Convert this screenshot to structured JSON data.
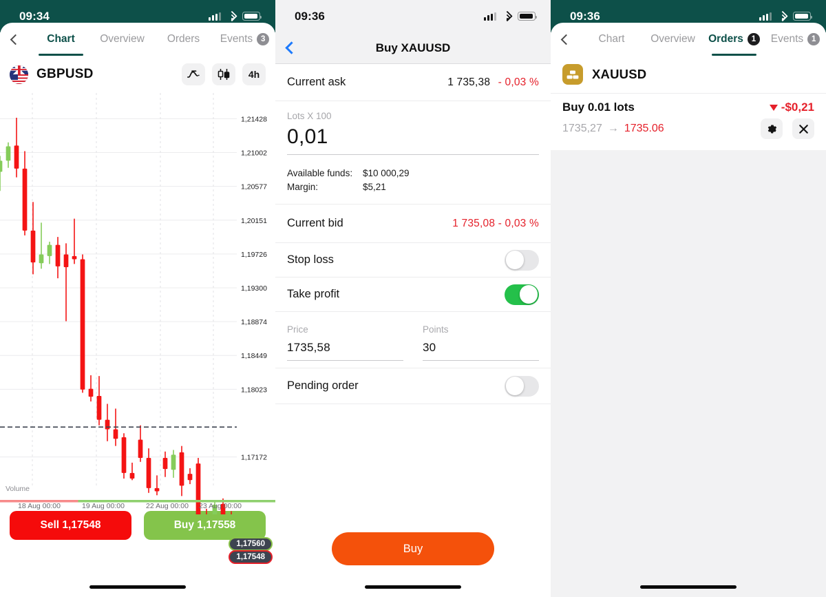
{
  "panel1": {
    "status": {
      "time": "09:34",
      "signal_icon": "cellular-bars-icon",
      "wifi_icon": "wifi-icon",
      "battery_icon": "battery-icon"
    },
    "back_icon": "back-chevron-icon",
    "tabs": [
      {
        "label": "Chart",
        "badge": "",
        "active": true
      },
      {
        "label": "Overview",
        "badge": "",
        "active": false
      },
      {
        "label": "Orders",
        "badge": "",
        "active": false
      },
      {
        "label": "Events",
        "badge": "3",
        "active": false
      }
    ],
    "symbol": {
      "name": "GBPUSD",
      "flag_icon": "gbpusd-flag-icon"
    },
    "tools": [
      {
        "name": "indicators-icon",
        "label": ""
      },
      {
        "name": "candlestick-chart-type-icon",
        "label": ""
      },
      {
        "name": "timeframe-button",
        "label": "4h"
      }
    ],
    "price_tags": {
      "ask": "1,17560",
      "bid": "1,17548"
    },
    "buttons": {
      "sell": "Sell 1,17548",
      "buy": "Buy 1,17558"
    },
    "colors": {
      "teal": "#0d5049",
      "sell_red": "#f50b0b",
      "buy_green": "#84c44b",
      "bull": "#85cc5a",
      "bear": "#f41414"
    }
  },
  "chart_data": {
    "type": "candlestick",
    "title": "GBPUSD",
    "timeframe": "4h",
    "volume_label": "Volume",
    "ylabel": "",
    "xlabel": "",
    "ytick_labels": [
      "1,21428",
      "1,21002",
      "1,20577",
      "1,20151",
      "1,19726",
      "1,19300",
      "1,18874",
      "1,18449",
      "1,18023",
      "1,17172"
    ],
    "ytick_values": [
      1.21428,
      1.21002,
      1.20577,
      1.20151,
      1.19726,
      1.193,
      1.18874,
      1.18449,
      1.18023,
      1.17172
    ],
    "xtick_labels": [
      "18 Aug 00:00",
      "19 Aug 00:00",
      "22 Aug 00:00",
      "23 Aug 00:00"
    ],
    "ylim": [
      1.169,
      1.217
    ],
    "grid": true,
    "current_ask_line": 1.1756,
    "current_bid_line": 1.17548,
    "candles": [
      {
        "o": 1.2076,
        "h": 1.2096,
        "l": 1.2052,
        "c": 1.209
      },
      {
        "o": 1.209,
        "h": 1.2113,
        "l": 1.2081,
        "c": 1.2108
      },
      {
        "o": 1.2109,
        "h": 1.2144,
        "l": 1.2069,
        "c": 1.208
      },
      {
        "o": 1.208,
        "h": 1.2102,
        "l": 1.1996,
        "c": 1.2002
      },
      {
        "o": 1.2002,
        "h": 1.2038,
        "l": 1.1947,
        "c": 1.1962
      },
      {
        "o": 1.1961,
        "h": 1.2012,
        "l": 1.1954,
        "c": 1.1972
      },
      {
        "o": 1.197,
        "h": 1.1988,
        "l": 1.196,
        "c": 1.1984
      },
      {
        "o": 1.1984,
        "h": 1.1994,
        "l": 1.1942,
        "c": 1.1957
      },
      {
        "o": 1.1972,
        "h": 1.1986,
        "l": 1.1888,
        "c": 1.1956
      },
      {
        "o": 1.197,
        "h": 1.2017,
        "l": 1.196,
        "c": 1.1966
      },
      {
        "o": 1.1966,
        "h": 1.1972,
        "l": 1.1798,
        "c": 1.1802
      },
      {
        "o": 1.1803,
        "h": 1.182,
        "l": 1.1787,
        "c": 1.1793
      },
      {
        "o": 1.1794,
        "h": 1.1819,
        "l": 1.1757,
        "c": 1.1764
      },
      {
        "o": 1.1764,
        "h": 1.1784,
        "l": 1.1737,
        "c": 1.1752
      },
      {
        "o": 1.1752,
        "h": 1.1778,
        "l": 1.1731,
        "c": 1.174
      },
      {
        "o": 1.1742,
        "h": 1.1747,
        "l": 1.169,
        "c": 1.1697
      },
      {
        "o": 1.1697,
        "h": 1.171,
        "l": 1.1688,
        "c": 1.169
      },
      {
        "o": 1.1739,
        "h": 1.1757,
        "l": 1.1711,
        "c": 1.1716
      },
      {
        "o": 1.1716,
        "h": 1.1728,
        "l": 1.1672,
        "c": 1.1678
      },
      {
        "o": 1.1678,
        "h": 1.1694,
        "l": 1.1669,
        "c": 1.1674
      },
      {
        "o": 1.1716,
        "h": 1.1724,
        "l": 1.1692,
        "c": 1.1702
      },
      {
        "o": 1.1701,
        "h": 1.1726,
        "l": 1.1691,
        "c": 1.172
      },
      {
        "o": 1.1723,
        "h": 1.1731,
        "l": 1.1668,
        "c": 1.1681
      },
      {
        "o": 1.1696,
        "h": 1.1703,
        "l": 1.1683,
        "c": 1.1688
      },
      {
        "o": 1.1709,
        "h": 1.1716,
        "l": 1.1637,
        "c": 1.1644
      },
      {
        "o": 1.1644,
        "h": 1.1652,
        "l": 1.1632,
        "c": 1.164
      },
      {
        "o": 1.1642,
        "h": 1.1661,
        "l": 1.1638,
        "c": 1.1657
      },
      {
        "o": 1.1658,
        "h": 1.1665,
        "l": 1.1637,
        "c": 1.1642
      },
      {
        "o": 1.1643,
        "h": 1.1649,
        "l": 1.1562,
        "c": 1.1636
      }
    ],
    "volume_series_split": 0.33
  },
  "panel2": {
    "status": {
      "time": "09:36",
      "signal_icon": "cellular-bars-icon",
      "wifi_icon": "wifi-icon",
      "battery_icon": "battery-icon"
    },
    "back_icon": "back-chevron-icon",
    "title": "Buy XAUUSD",
    "current_ask": {
      "label": "Current ask",
      "value": "1 735,38",
      "change": "- 0,03 %"
    },
    "lots": {
      "caption": "Lots X 100",
      "value": "0,01"
    },
    "funds": {
      "available_label": "Available funds:",
      "available_value": "$10 000,29",
      "margin_label": "Margin:",
      "margin_value": "$5,21"
    },
    "current_bid": {
      "label": "Current bid",
      "value": "1 735,08",
      "change": "- 0,03 %"
    },
    "stop_loss": {
      "label": "Stop loss",
      "on": false
    },
    "take_profit": {
      "label": "Take profit",
      "on": true
    },
    "price_field": {
      "caption": "Price",
      "value": "1735,58"
    },
    "points_field": {
      "caption": "Points",
      "value": "30"
    },
    "pending_order": {
      "label": "Pending order",
      "on": false
    },
    "cta": "Buy",
    "colors": {
      "cta_orange": "#f4510b",
      "toggle_on": "#24c04a",
      "red": "#e5202a",
      "blue": "#1d7afc"
    }
  },
  "panel3": {
    "status": {
      "time": "09:36",
      "signal_icon": "cellular-bars-icon",
      "wifi_icon": "wifi-icon",
      "battery_icon": "battery-icon"
    },
    "back_icon": "back-chevron-icon",
    "tabs": [
      {
        "label": "Chart",
        "badge": "",
        "active": false
      },
      {
        "label": "Overview",
        "badge": "",
        "active": false
      },
      {
        "label": "Orders",
        "badge": "1",
        "active": true
      },
      {
        "label": "Events",
        "badge": "1",
        "active": false
      }
    ],
    "symbol": {
      "name": "XAUUSD",
      "icon": "gold-bars-icon"
    },
    "order": {
      "title": "Buy 0.01 lots",
      "pnl": "-$0,21",
      "pnl_direction_icon": "triangle-down-icon",
      "open_price": "1735,27",
      "arrow": "→",
      "current_price": "1735.06",
      "settings_icon": "gear-icon",
      "close_icon": "close-icon"
    },
    "colors": {
      "teal": "#0d5049",
      "gold": "#c79c2c",
      "red": "#e5202a"
    }
  }
}
